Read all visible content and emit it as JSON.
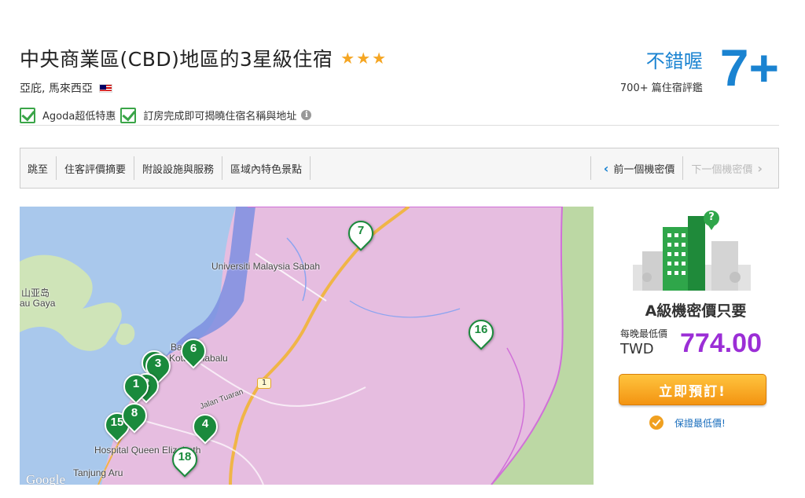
{
  "hotel": {
    "title": "中央商業區(CBD)地區的3星級住宿",
    "stars": [
      "★",
      "★",
      "★"
    ],
    "location": "亞庇, 馬來西亞",
    "flag": "malaysia-flag"
  },
  "rating": {
    "word": "不錯喔",
    "count": "700+ 篇住宿評鑑",
    "score": "7+"
  },
  "features": {
    "item1": "Agoda超低特惠",
    "item2": "訂房完成即可揭曉住宿名稱與地址",
    "info_glyph": "i"
  },
  "nav": {
    "jump_to": "跳至",
    "reviews": "住客評價摘要",
    "facilities": "附設設施與服務",
    "attractions": "區域內特色景點",
    "prev": "前一個機密價",
    "next": "下一個機密價",
    "prev_icon": "‹",
    "next_icon": "›"
  },
  "map": {
    "labels": {
      "ums": "Universiti Malaysia Sabah",
      "island": "山亚岛",
      "gaya": "au Gaya",
      "bandar": "Bandar",
      "kk": "Kota Kinabalu",
      "hospital": "Hospital Queen Elizabeth",
      "tuaran": "Jalan Tuaran",
      "tanjung": "Tanjung Aru",
      "route": "1",
      "google": "Google"
    },
    "pins": {
      "p7": "7",
      "p16": "16",
      "p6": "6",
      "p3": "3",
      "p1": "1",
      "p8": "8",
      "p2": "2",
      "p15": "15",
      "p4": "4",
      "p18": "18"
    }
  },
  "deal": {
    "heading": "A級機密價只要",
    "price_label": "每晚最低價",
    "currency": "TWD",
    "price": "774.00",
    "book_label": "立即預訂!",
    "guarantee": "保證最低價!"
  },
  "colors": {
    "accent_blue": "#1a83d1",
    "price_purple": "#9b2ed6",
    "check_green": "#3aa548",
    "pin_green": "#1a8a3c",
    "button_orange": "#f39412"
  }
}
